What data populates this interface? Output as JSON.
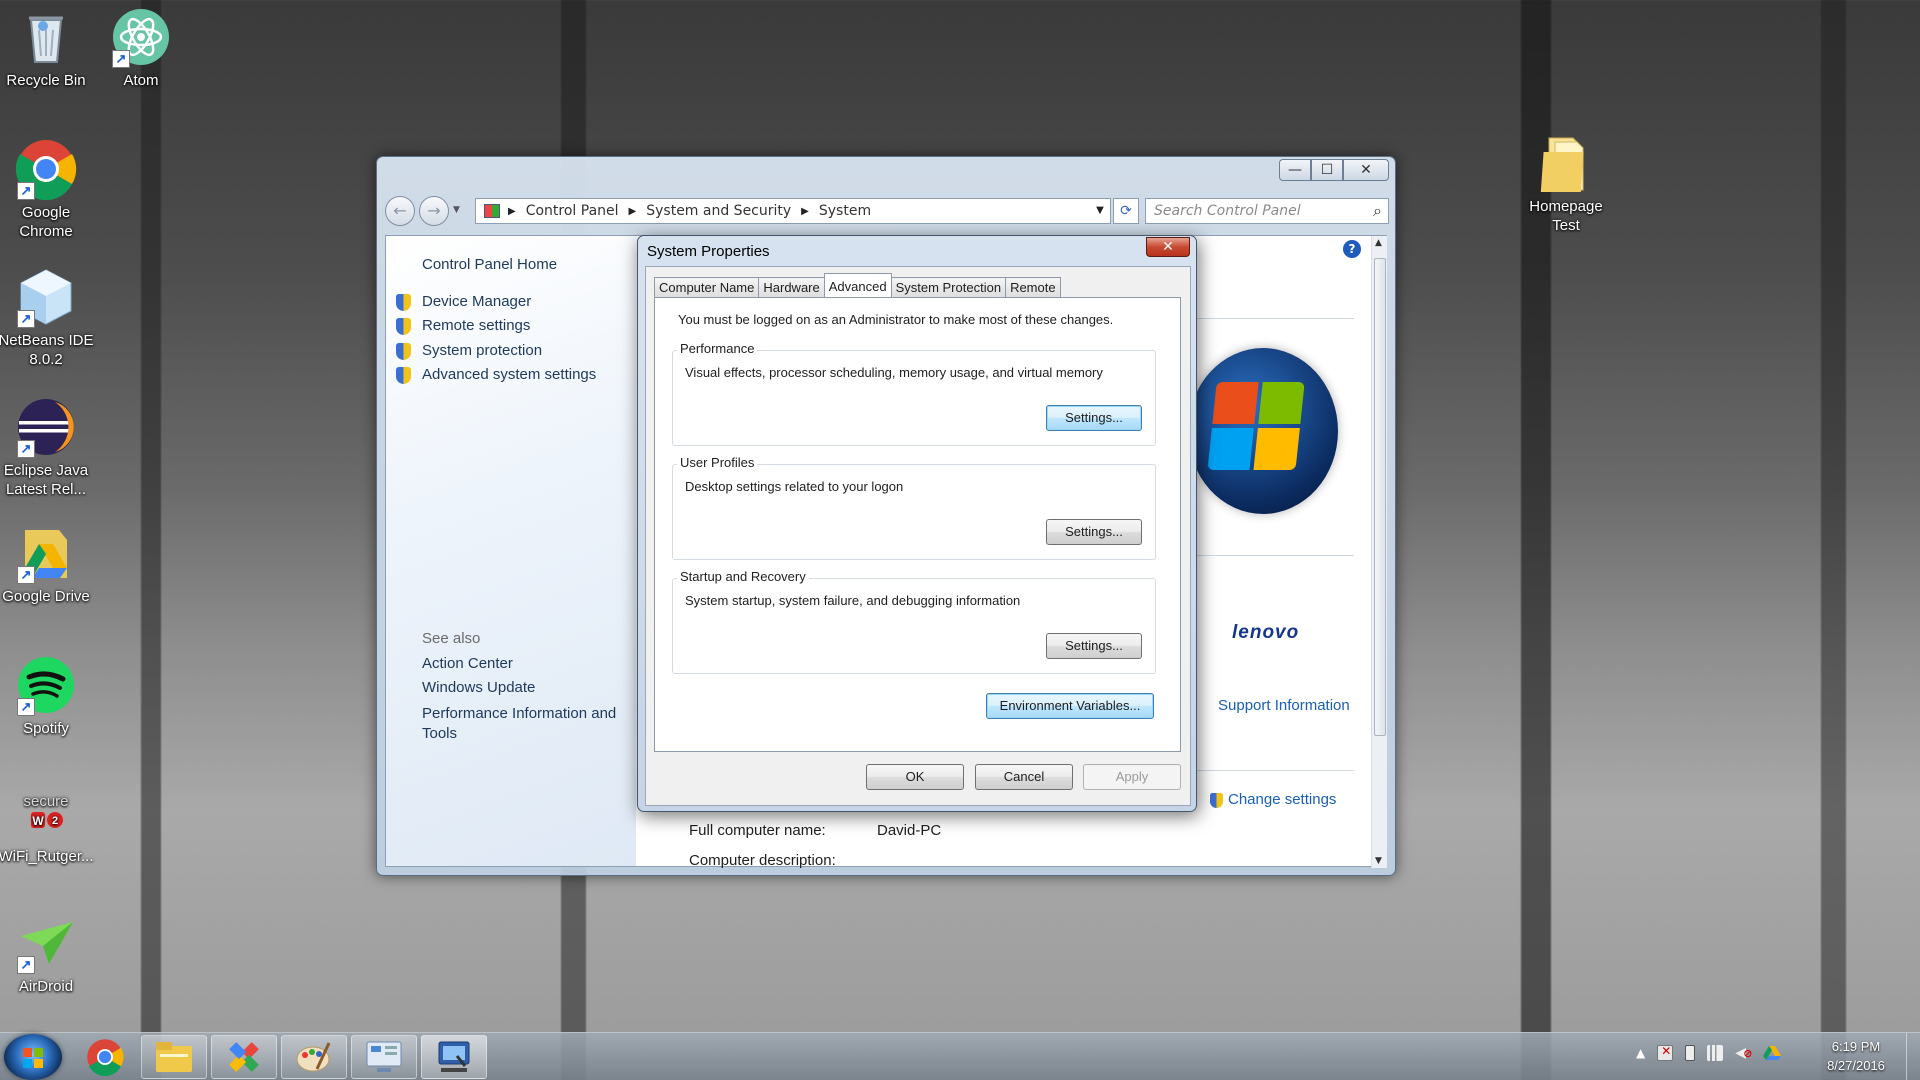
{
  "desktop": {
    "icons": [
      {
        "label": "Recycle Bin",
        "icon": "recycle-bin-icon"
      },
      {
        "label": "Atom",
        "icon": "atom-icon"
      },
      {
        "label": "Google Chrome",
        "icon": "chrome-icon"
      },
      {
        "label": "NetBeans IDE 8.0.2",
        "icon": "netbeans-icon"
      },
      {
        "label": "Eclipse Java Latest Rel...",
        "icon": "eclipse-icon"
      },
      {
        "label": "Google Drive",
        "icon": "google-drive-icon"
      },
      {
        "label": "Spotify",
        "icon": "spotify-icon"
      },
      {
        "label": "WiFi_Rutger...",
        "icon": "securew2-icon"
      },
      {
        "label": "AirDroid",
        "icon": "airdroid-icon"
      },
      {
        "label": "Homepage Test",
        "icon": "folder-icon"
      }
    ],
    "securew2_logo_text": "secure W2"
  },
  "explorer": {
    "breadcrumb": [
      "Control Panel",
      "System and Security",
      "System"
    ],
    "search_placeholder": "Search Control Panel",
    "left_pane": {
      "home": "Control Panel Home",
      "links": [
        "Device Manager",
        "Remote settings",
        "System protection",
        "Advanced system settings"
      ],
      "see_also_heading": "See also",
      "see_also": [
        "Action Center",
        "Windows Update",
        "Performance Information and Tools"
      ]
    },
    "right_pane": {
      "brand": "lenovo",
      "support_link": "Support Information",
      "change_settings": "Change settings",
      "full_computer_name_label": "Full computer name:",
      "full_computer_name_value": "David-PC",
      "computer_description_label": "Computer description:"
    },
    "caption_buttons": {
      "minimize": "—",
      "maximize": "☐",
      "close": "✕"
    }
  },
  "dialog": {
    "title": "System Properties",
    "tabs": [
      "Computer Name",
      "Hardware",
      "Advanced",
      "System Protection",
      "Remote"
    ],
    "active_tab": "Advanced",
    "intro": "You must be logged on as an Administrator to make most of these changes.",
    "groups": [
      {
        "title": "Performance",
        "description": "Visual effects, processor scheduling, memory usage, and virtual memory",
        "button": "Settings..."
      },
      {
        "title": "User Profiles",
        "description": "Desktop settings related to your logon",
        "button": "Settings..."
      },
      {
        "title": "Startup and Recovery",
        "description": "System startup, system failure, and debugging information",
        "button": "Settings..."
      }
    ],
    "env_button": "Environment Variables...",
    "ok": "OK",
    "cancel": "Cancel",
    "apply": "Apply"
  },
  "taskbar": {
    "apps": [
      "chrome-icon",
      "file-explorer-icon",
      "pinwheel-app-icon",
      "paint-icon",
      "control-panel-icon",
      "system-properties-icon"
    ],
    "tray": [
      "chevron-up-icon",
      "action-center-flag-icon",
      "battery-icon",
      "network-icon",
      "volume-muted-icon",
      "google-drive-icon"
    ],
    "time": "6:19 PM",
    "date": "8/27/2016"
  },
  "colors": {
    "link": "#1a5fb4",
    "nav_link": "#1e395b",
    "focus_button": "#3c7fb1",
    "dialog_close": "#c74a33"
  }
}
